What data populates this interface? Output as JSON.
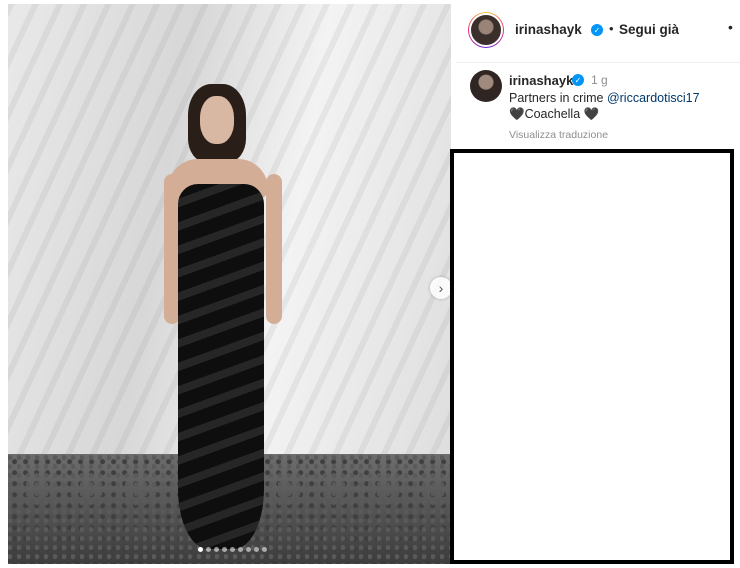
{
  "post": {
    "username": "irinashayk",
    "follow_status": "Segui già",
    "separator": "•",
    "more_icon": "more-horizontal-icon"
  },
  "comment": {
    "username": "irinashayk",
    "time": "1 g",
    "caption_text": "Partners in crime ",
    "mention": "@riccardotisci17",
    "caption_line2": "🖤Coachella 🖤",
    "translate_link": "Visualizza traduzione"
  },
  "media": {
    "carousel_count": 9,
    "active_index": 0,
    "next_icon": "chevron-right-icon"
  },
  "colors": {
    "verified": "#0095f6",
    "mention": "#00376b",
    "muted": "#8e8e8e"
  }
}
